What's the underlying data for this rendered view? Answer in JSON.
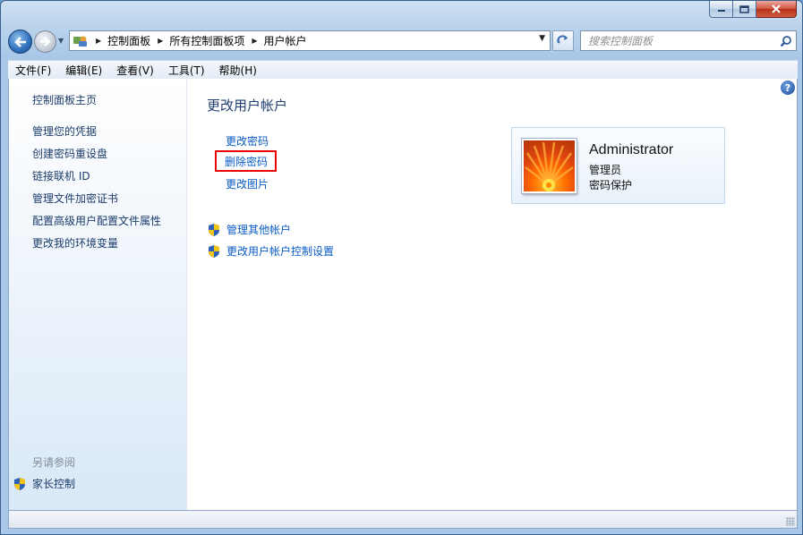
{
  "window": {
    "caption_buttons": [
      "minimize",
      "maximize",
      "close"
    ]
  },
  "address_bar": {
    "breadcrumbs": [
      "控制面板",
      "所有控制面板项",
      "用户帐户"
    ]
  },
  "search": {
    "placeholder": "搜索控制面板"
  },
  "menu": {
    "items": [
      "文件(F)",
      "编辑(E)",
      "查看(V)",
      "工具(T)",
      "帮助(H)"
    ]
  },
  "sidebar": {
    "home": "控制面板主页",
    "links": [
      "管理您的凭据",
      "创建密码重设盘",
      "链接联机 ID",
      "管理文件加密证书",
      "配置高级用户配置文件属性",
      "更改我的环境变量"
    ],
    "see_also": "另请参阅",
    "parental_controls": "家长控制"
  },
  "main": {
    "title": "更改用户帐户",
    "tasks": [
      "更改密码",
      "删除密码",
      "更改图片"
    ],
    "highlighted_task": "删除密码",
    "admin_links": [
      "管理其他帐户",
      "更改用户帐户控制设置"
    ]
  },
  "user": {
    "name": "Administrator",
    "role": "管理员",
    "status": "密码保护"
  },
  "colors": {
    "link": "#0a5bc4",
    "highlight_border": "#e00000",
    "title": "#1e3e6f"
  },
  "icons": {
    "help": "help-icon",
    "shield": "uac-shield-icon",
    "back": "back-arrow-icon",
    "forward": "forward-arrow-icon",
    "refresh": "refresh-icon",
    "search": "magnifier-icon"
  }
}
